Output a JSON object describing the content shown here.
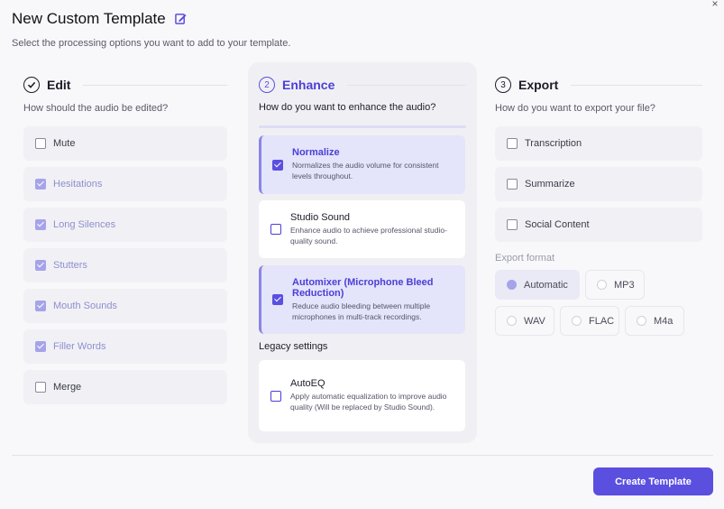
{
  "header": {
    "title": "New Custom Template",
    "subtitle": "Select the processing options you want to add to your template.",
    "close_glyph": "×"
  },
  "edit": {
    "step": "✓",
    "title": "Edit",
    "question": "How should the audio be edited?",
    "options": [
      {
        "label": "Mute",
        "checked": false
      },
      {
        "label": "Hesitations",
        "checked": true
      },
      {
        "label": "Long Silences",
        "checked": true
      },
      {
        "label": "Stutters",
        "checked": true
      },
      {
        "label": "Mouth Sounds",
        "checked": true
      },
      {
        "label": "Filler Words",
        "checked": true
      },
      {
        "label": "Merge",
        "checked": false
      }
    ]
  },
  "enhance": {
    "step": "2",
    "title": "Enhance",
    "question": "How do you want to enhance the audio?",
    "options": [
      {
        "title": "Normalize",
        "desc": "Normalizes the audio volume for consistent levels throughout.",
        "checked": true
      },
      {
        "title": "Studio Sound",
        "desc": "Enhance audio to achieve professional studio-quality sound.",
        "checked": false
      },
      {
        "title": "Automixer (Microphone Bleed Reduction)",
        "desc": "Reduce audio bleeding between multiple microphones in multi-track recordings.",
        "checked": true
      }
    ],
    "legacy_label": "Legacy settings",
    "legacy": [
      {
        "title": "AutoEQ",
        "desc": "Apply automatic equalization to improve audio quality (Will be replaced by Studio Sound).",
        "checked": false
      }
    ]
  },
  "export": {
    "step": "3",
    "title": "Export",
    "question": "How do you want to export your file?",
    "options": [
      {
        "label": "Transcription",
        "checked": false
      },
      {
        "label": "Summarize",
        "checked": false
      },
      {
        "label": "Social Content",
        "checked": false
      }
    ],
    "format_label": "Export format",
    "formats_row1": [
      {
        "label": "Automatic",
        "selected": true
      },
      {
        "label": "MP3",
        "selected": false
      }
    ],
    "formats_row2": [
      {
        "label": "WAV",
        "selected": false
      },
      {
        "label": "FLAC",
        "selected": false
      },
      {
        "label": "M4a",
        "selected": false
      }
    ]
  },
  "footer": {
    "create_label": "Create Template"
  },
  "colors": {
    "accent": "#5b4fe0",
    "accent_light": "#a7a3ea",
    "selected_card": "#e4e4fa"
  }
}
